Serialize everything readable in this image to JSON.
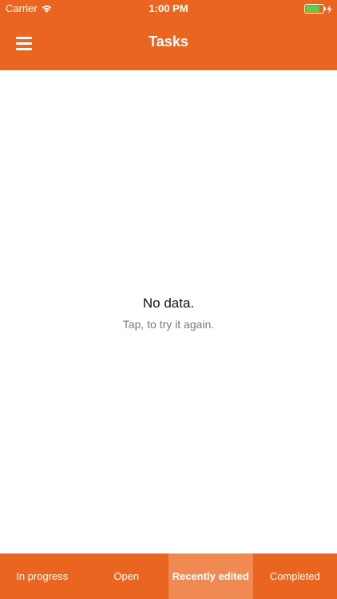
{
  "status_bar": {
    "carrier": "Carrier",
    "time": "1:00 PM",
    "wifi_icon": "wifi-icon",
    "battery_icon": "battery-charging-icon",
    "battery_level_percent": 80,
    "battery_color": "#5bd043"
  },
  "header": {
    "title": "Tasks",
    "menu_icon": "hamburger-menu-icon",
    "background_color": "#ea6520"
  },
  "empty_state": {
    "title": "No data.",
    "subtitle": "Tap, to try it again."
  },
  "tabs": {
    "active_index": 2,
    "active_color": "#f08a53",
    "items": [
      {
        "label": "In progress"
      },
      {
        "label": "Open"
      },
      {
        "label": "Recently edited"
      },
      {
        "label": "Completed"
      }
    ]
  }
}
